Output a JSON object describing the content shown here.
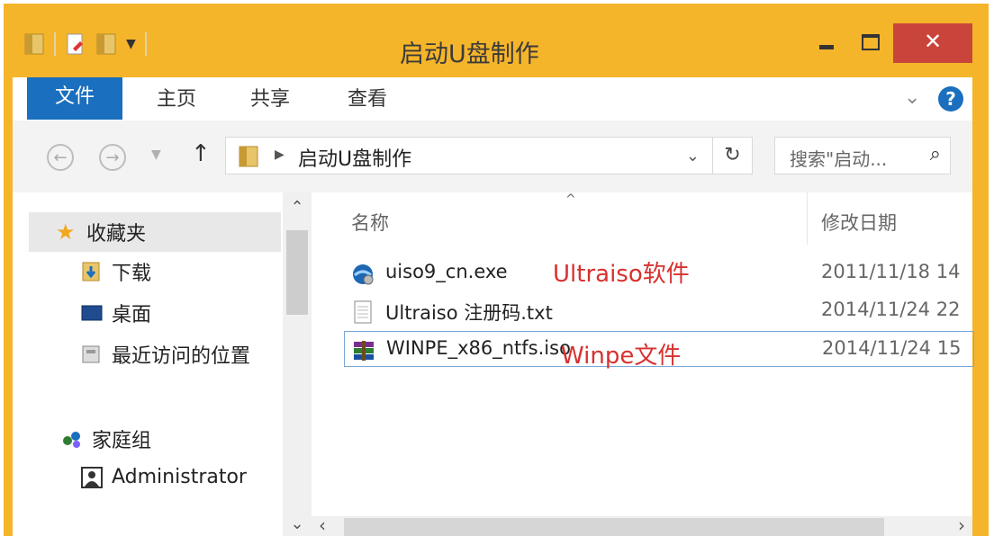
{
  "window": {
    "title": "启动U盘制作"
  },
  "ribbon": {
    "tabs": {
      "file": "文件",
      "home": "主页",
      "share": "共享",
      "view": "查看"
    },
    "help": "?"
  },
  "nav": {
    "address": "启动U盘制作",
    "search_placeholder": "搜索\"启动...",
    "up": "↑",
    "back": "←",
    "forward": "→",
    "refresh": "↻",
    "search_glyph": "⌕"
  },
  "navpane": {
    "favorites": "收藏夹",
    "downloads": "下载",
    "desktop": "桌面",
    "recent": "最近访问的位置",
    "homegroup": "家庭组",
    "admin": "Administrator"
  },
  "columns": {
    "name": "名称",
    "modified": "修改日期"
  },
  "files": [
    {
      "name": "uiso9_cn.exe",
      "date": "2011/11/18 14",
      "note": "Ultraiso软件"
    },
    {
      "name": "Ultraiso 注册码.txt",
      "date": "2014/11/24 22",
      "note": ""
    },
    {
      "name": "WINPE_x86_ntfs.iso",
      "date": "2014/11/24 15",
      "note": "Winpe文件"
    }
  ],
  "colors": {
    "title_bar": "#f5b52a",
    "file_tab": "#1a6fbe",
    "close_button": "#c9443a",
    "annotation": "#d7312f"
  }
}
